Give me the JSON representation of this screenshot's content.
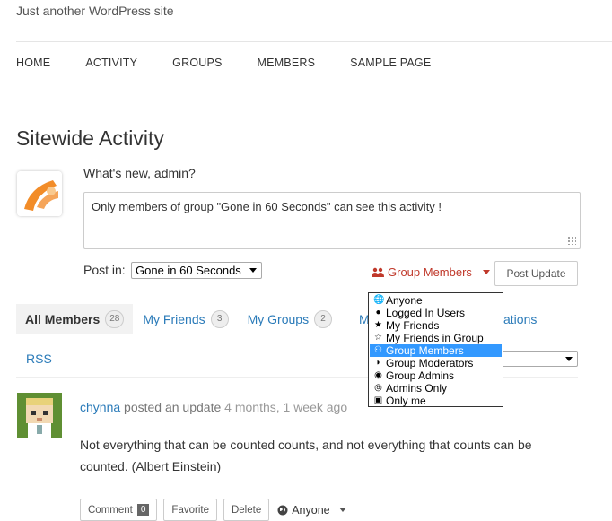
{
  "site": {
    "tagline": "Just another WordPress site"
  },
  "nav": {
    "items": [
      "HOME",
      "ACTIVITY",
      "GROUPS",
      "MEMBERS",
      "SAMPLE PAGE"
    ]
  },
  "page": {
    "title": "Sitewide Activity"
  },
  "post_form": {
    "whats_new": "What's new, admin?",
    "textarea_value": "Only members of group \"Gone in 60 Seconds\" can see this activity !",
    "post_in_label": "Post in:",
    "post_in_value": "Gone in 60 Seconds",
    "privacy_label": "Group Members",
    "submit_label": "Post Update"
  },
  "privacy_options": [
    {
      "label": "Anyone",
      "icon": "globe-icon"
    },
    {
      "label": "Logged In Users",
      "icon": "user-icon"
    },
    {
      "label": "My Friends",
      "icon": "star-icon"
    },
    {
      "label": "My Friends in Group",
      "icon": "star-outline-icon"
    },
    {
      "label": "Group Members",
      "icon": "users-icon",
      "selected": true
    },
    {
      "label": "Group Moderators",
      "icon": "shield-icon"
    },
    {
      "label": "Group Admins",
      "icon": "eye-slash-icon"
    },
    {
      "label": "Admins Only",
      "icon": "eye-icon"
    },
    {
      "label": "Only me",
      "icon": "lock-icon"
    }
  ],
  "tabs": [
    {
      "label": "All Members",
      "count": "28",
      "active": true
    },
    {
      "label": "My Friends",
      "count": "3"
    },
    {
      "label": "My Groups",
      "count": "2"
    }
  ],
  "tab_partial_left": "M",
  "tab_partial_right": "ations",
  "rss_label": "RSS",
  "activity": {
    "author": "chynna",
    "action": "posted an update",
    "time": "4 months, 1 week ago",
    "content": "Not everything that can be counted counts, and not everything that counts can be counted. (Albert Einstein)",
    "comment_label": "Comment",
    "comment_count": "0",
    "favorite_label": "Favorite",
    "delete_label": "Delete",
    "privacy_label": "Anyone"
  },
  "colors": {
    "link": "#2b7bb9",
    "privacy_accent": "#c0392b",
    "dropdown_highlight": "#3399ff"
  }
}
